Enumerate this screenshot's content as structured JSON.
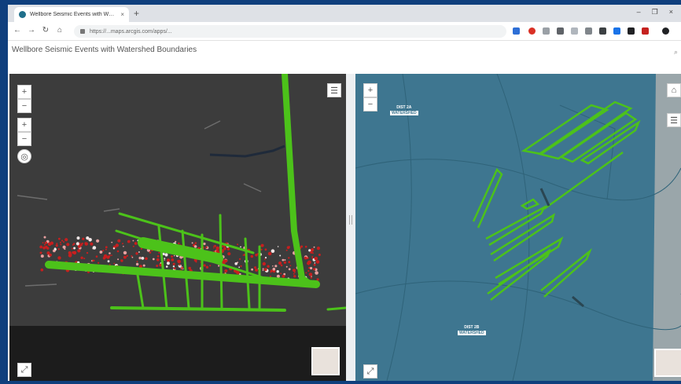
{
  "browser": {
    "tab_title": "Wellbore Seismic Events with W…",
    "tab_close": "×",
    "new_tab": "+",
    "window_controls": [
      "–",
      "❐",
      "×"
    ],
    "url": "https://...maps.arcgis.com/apps/..."
  },
  "app": {
    "title": "Wellbore Seismic Events with Watershed Boundaries",
    "search_glyph": "⌕"
  },
  "scene": {
    "zoom_in": "+",
    "zoom_out": "−",
    "tilt_in": "+",
    "tilt_out": "−",
    "compass": "◎"
  },
  "map": {
    "zoom_in": "+",
    "zoom_out": "−",
    "labels": [
      {
        "top": "DIST 2A",
        "bar": "WATERSHED"
      },
      {
        "top": "DIST 2B",
        "bar": "WATERSHED"
      }
    ]
  },
  "colors": {
    "wellbore": "#4cc21a",
    "seismic": "#c81e1e",
    "map_water": "#3e7690",
    "scene_bg": "#3c3c3c",
    "frame": "#0f3f7d"
  }
}
